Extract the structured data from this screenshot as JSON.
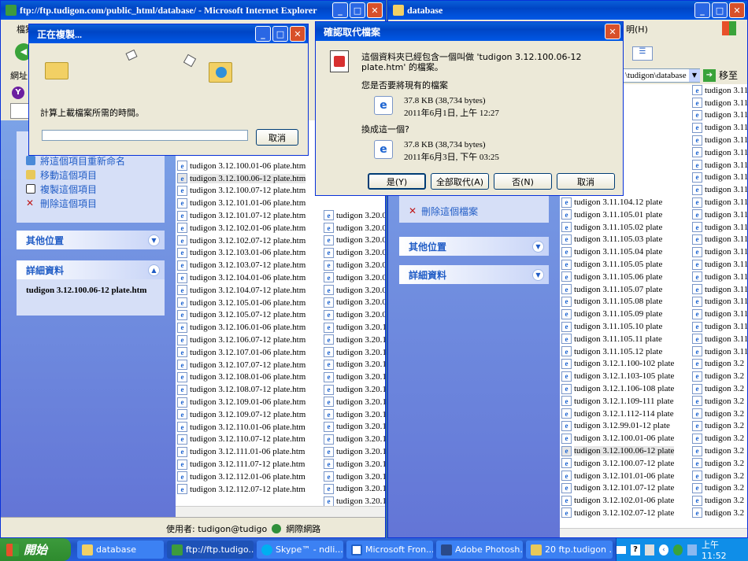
{
  "ie_window": {
    "title": "ftp://ftp.tudigon.com/public_html/database/ - Microsoft Internet Explorer",
    "menu_label": "檔案",
    "address_label": "網址",
    "tasks": [
      "將這個項目重新命名",
      "移動這個項目",
      "複製這個項目",
      "刪除這個項目"
    ],
    "other_places": "其他位置",
    "details": "詳細資料",
    "details_name": "tudigon 3.12.100.06-12 plate.htm",
    "files_col1": [
      "tudigon 3.12.100.01-06 plate.htm",
      "tudigon 3.12.100.06-12 plate.htm",
      "tudigon 3.12.100.07-12 plate.htm",
      "tudigon 3.12.101.01-06 plate.htm",
      "tudigon 3.12.101.07-12 plate.htm",
      "tudigon 3.12.102.01-06 plate.htm",
      "tudigon 3.12.102.07-12 plate.htm",
      "tudigon 3.12.103.01-06 plate.htm",
      "tudigon 3.12.103.07-12 plate.htm",
      "tudigon 3.12.104.01-06 plate.htm",
      "tudigon 3.12.104.07-12 plate.htm",
      "tudigon 3.12.105.01-06 plate.htm",
      "tudigon 3.12.105.07-12 plate.htm",
      "tudigon 3.12.106.01-06 plate.htm",
      "tudigon 3.12.106.07-12 plate.htm",
      "tudigon 3.12.107.01-06 plate.htm",
      "tudigon 3.12.107.07-12 plate.htm",
      "tudigon 3.12.108.01-06 plate.htm",
      "tudigon 3.12.108.07-12 plate.htm",
      "tudigon 3.12.109.01-06 plate.htm",
      "tudigon 3.12.109.07-12 plate.htm",
      "tudigon 3.12.110.01-06 plate.htm",
      "tudigon 3.12.110.07-12 plate.htm",
      "tudigon 3.12.111.01-06 plate.htm",
      "tudigon 3.12.111.07-12 plate.htm",
      "tudigon 3.12.112.01-06 plate.htm",
      "tudigon 3.12.112.07-12 plate.htm"
    ],
    "files_col2": [
      "tudigon 3.20.0",
      "tudigon 3.20.0",
      "tudigon 3.20.0",
      "tudigon 3.20.0",
      "tudigon 3.20.0",
      "tudigon 3.20.0",
      "tudigon 3.20.0",
      "tudigon 3.20.0",
      "tudigon 3.20.0",
      "tudigon 3.20.1",
      "tudigon 3.20.1",
      "tudigon 3.20.1",
      "tudigon 3.20.1",
      "tudigon 3.20.1",
      "tudigon 3.20.1",
      "tudigon 3.20.1",
      "tudigon 3.20.1",
      "tudigon 3.20.1",
      "tudigon 3.20.1",
      "tudigon 3.20.1",
      "tudigon 3.20.1",
      "tudigon 3.20.1",
      "tudigon 3.20.1",
      "tudigon 3.20.1"
    ],
    "status_user": "使用者: tudigon@tudigo",
    "status_zone": "網際網路"
  },
  "db_window": {
    "title": "database",
    "menu_label": "明(H)",
    "address_value": "\\tudigon\\database",
    "go_label": "移至",
    "delete_task": "刪除這個檔案",
    "other_places": "其他位置",
    "details": "詳細資料",
    "files_col1": [
      "04.03 plate",
      "04.04 plate",
      "04.05 plate",
      "04.06 plate",
      "04.07 plate",
      "04.08 plate",
      "04.09 plate",
      "04.10 plate",
      "04.11 plate",
      "tudigon 3.11.104.12 plate",
      "tudigon 3.11.105.01 plate",
      "tudigon 3.11.105.02 plate",
      "tudigon 3.11.105.03 plate",
      "tudigon 3.11.105.04 plate",
      "tudigon 3.11.105.05 plate",
      "tudigon 3.11.105.06 plate",
      "tudigon 3.11.105.07 plate",
      "tudigon 3.11.105.08 plate",
      "tudigon 3.11.105.09 plate",
      "tudigon 3.11.105.10 plate",
      "tudigon 3.11.105.11 plate",
      "tudigon 3.11.105.12 plate",
      "tudigon 3.12.1.100-102 plate",
      "tudigon 3.12.1.103-105 plate",
      "tudigon 3.12.1.106-108 plate",
      "tudigon 3.12.1.109-111 plate",
      "tudigon 3.12.1.112-114 plate",
      "tudigon 3.12.99.01-12 plate",
      "tudigon 3.12.100.01-06 plate",
      "tudigon 3.12.100.06-12 plate",
      "tudigon 3.12.100.07-12 plate",
      "tudigon 3.12.101.01-06 plate",
      "tudigon 3.12.101.07-12 plate",
      "tudigon 3.12.102.01-06 plate",
      "tudigon 3.12.102.07-12 plate"
    ],
    "files_col2": [
      "tudigon 3.11",
      "tudigon 3.11",
      "tudigon 3.11",
      "tudigon 3.11",
      "tudigon 3.11",
      "tudigon 3.11",
      "tudigon 3.11",
      "tudigon 3.11",
      "tudigon 3.11",
      "tudigon 3.11",
      "tudigon 3.11",
      "tudigon 3.11",
      "tudigon 3.11",
      "tudigon 3.11",
      "tudigon 3.11",
      "tudigon 3.11",
      "tudigon 3.11",
      "tudigon 3.11",
      "tudigon 3.11",
      "tudigon 3.11",
      "tudigon 3.11",
      "tudigon 3.11",
      "tudigon 3.2",
      "tudigon 3.2",
      "tudigon 3.2",
      "tudigon 3.2",
      "tudigon 3.2",
      "tudigon 3.2",
      "tudigon 3.2",
      "tudigon 3.2",
      "tudigon 3.2",
      "tudigon 3.2",
      "tudigon 3.2",
      "tudigon 3.2",
      "tudigon 3.2"
    ]
  },
  "copy_dialog": {
    "title": "正在複製...",
    "message": "計算上載檔案所需的時間。",
    "cancel": "取消",
    "progress": 0
  },
  "confirm_dialog": {
    "title": "確認取代檔案",
    "line1": "這個資料夾已經包含一個叫做 'tudigon 3.12.100.06-12 plate.htm' 的檔案。",
    "q1": "您是否要將現有的檔案",
    "existing_size": "37.8 KB (38,734 bytes)",
    "existing_date": "2011年6月1日, 上午 12:27",
    "q2": "換成這一個?",
    "new_size": "37.8 KB (38,734 bytes)",
    "new_date": "2011年6月3日, 下午 03:25",
    "yes": "是(Y)",
    "yes_all": "全部取代(A)",
    "no": "否(N)",
    "cancel": "取消"
  },
  "taskbar": {
    "start": "開始",
    "items": [
      "database",
      "ftp://ftp.tudigo...",
      "Skype™ - ndli...",
      "Microsoft Fron...",
      "Adobe Photosh...",
      "20 ftp.tudigon ..."
    ],
    "clock": "上午 11:52"
  }
}
